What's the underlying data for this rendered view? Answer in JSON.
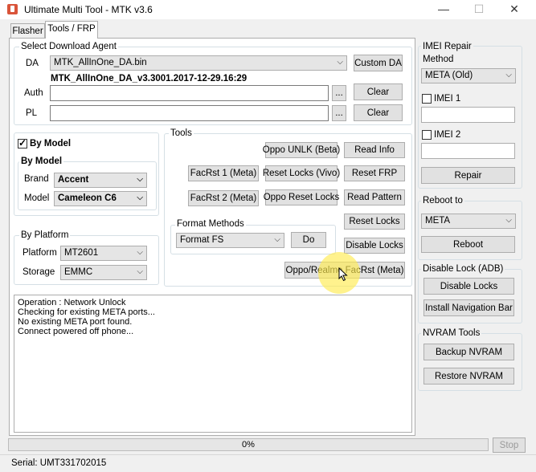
{
  "window": {
    "title": "Ultimate Multi Tool - MTK v3.6",
    "minimize": "—",
    "maximize": "☐",
    "close": "✕"
  },
  "tabs": [
    {
      "label": "Flasher"
    },
    {
      "label": "Tools / FRP",
      "active": true
    }
  ],
  "download_agent": {
    "group_title": "Select Download Agent",
    "da_label": "DA",
    "da_value": "MTK_AllInOne_DA.bin",
    "custom_da_label": "Custom DA",
    "da_version": "MTK_AllInOne_DA_v3.3001.2017-12-29.16:29",
    "auth_label": "Auth",
    "auth_value": "",
    "pl_label": "PL",
    "pl_value": "",
    "browse_label": "...",
    "clear_label": "Clear"
  },
  "by_model": {
    "checkbox_label": "By Model",
    "checked": true,
    "group_title": "By Model",
    "brand_label": "Brand",
    "brand_value": "Accent",
    "model_label": "Model",
    "model_value": "Cameleon C6"
  },
  "by_platform": {
    "group_title": "By Platform",
    "platform_label": "Platform",
    "platform_value": "MT2601",
    "storage_label": "Storage",
    "storage_value": "EMMC"
  },
  "tools": {
    "group_title": "Tools",
    "oppo_unlk": "Oppo UNLK (Beta)",
    "read_info": "Read Info",
    "facrst1": "FacRst 1 (Meta)",
    "reset_locks_vivo": "Reset Locks (Vivo)",
    "reset_frp": "Reset FRP",
    "facrst2": "FacRst 2 (Meta)",
    "oppo_reset_locks": "Oppo Reset Locks",
    "read_pattern": "Read Pattern",
    "reset_locks": "Reset Locks",
    "disable_locks": "Disable Locks",
    "oppo_realme_facrst": "Oppo/Realme FacRst (Meta)",
    "format_title": "Format Methods",
    "format_value": "Format FS",
    "do_label": "Do"
  },
  "log": {
    "lines": [
      "Operation : Network Unlock",
      "Checking for existing META ports...",
      "No existing META port found.",
      "Connect powered off phone..."
    ]
  },
  "progress": {
    "text": "0%",
    "value": 0,
    "stop_label": "Stop"
  },
  "imei_repair": {
    "group_title": "IMEI Repair",
    "method_label": "Method",
    "method_value": "META (Old)",
    "imei1_label": "IMEI 1",
    "imei1_value": "",
    "imei2_label": "IMEI 2",
    "imei2_value": "",
    "repair_label": "Repair"
  },
  "reboot": {
    "group_title": "Reboot to",
    "mode_value": "META",
    "reboot_label": "Reboot"
  },
  "disable_lock": {
    "group_title": "Disable Lock (ADB)",
    "disable_locks_label": "Disable Locks",
    "install_nav_label": "Install Navigation Bar"
  },
  "nvram": {
    "group_title": "NVRAM Tools",
    "backup_label": "Backup NVRAM",
    "restore_label": "Restore NVRAM"
  },
  "status": {
    "serial": "Serial: UMT331702015"
  },
  "icons": {
    "app": "app-icon",
    "dropdown": "chevron-down-icon",
    "cursor": "mouse-pointer-icon"
  }
}
